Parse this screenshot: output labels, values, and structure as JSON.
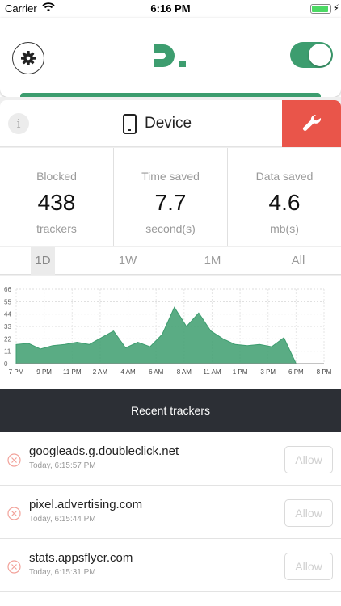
{
  "status_bar": {
    "carrier": "Carrier",
    "time": "6:16 PM"
  },
  "header": {
    "logo_icon": "disconnect-logo",
    "protection_on": true,
    "accent": "#3d9d6f"
  },
  "device": {
    "info_label": "i",
    "title": "Device",
    "wrench_color": "#e9554a"
  },
  "stats": [
    {
      "caption": "Blocked",
      "value": "438",
      "unit": "trackers"
    },
    {
      "caption": "Time saved",
      "value": "7.7",
      "unit": "second(s)"
    },
    {
      "caption": "Data saved",
      "value": "4.6",
      "unit": "mb(s)"
    }
  ],
  "range_tabs": [
    "1D",
    "1W",
    "1M",
    "All"
  ],
  "active_range": "1D",
  "chart_data": {
    "type": "area",
    "y_ticks": [
      0,
      11,
      22,
      33,
      44,
      55,
      66
    ],
    "ylim": [
      0,
      66
    ],
    "x_ticks": [
      "7 PM",
      "9 PM",
      "11 PM",
      "2 AM",
      "4 AM",
      "6 AM",
      "8 AM",
      "11 AM",
      "1 PM",
      "3 PM",
      "6 PM",
      "8 PM"
    ],
    "x": [
      0,
      1,
      2,
      3,
      4,
      5,
      6,
      7,
      8,
      9,
      10,
      11,
      12,
      13,
      14,
      15,
      16,
      17,
      18,
      19,
      20
    ],
    "values": [
      17,
      18,
      13,
      16,
      17,
      19,
      17,
      23,
      29,
      14,
      19,
      15,
      26,
      50,
      33,
      45,
      29,
      22,
      17,
      16,
      17,
      15,
      23,
      0
    ],
    "grid": true,
    "color": "#3d9d6f"
  },
  "recent": {
    "title": "Recent trackers",
    "items": [
      {
        "domain": "googleads.g.doubleclick.net",
        "time": "Today, 6:15:57 PM",
        "action": "Allow"
      },
      {
        "domain": "pixel.advertising.com",
        "time": "Today, 6:15:44 PM",
        "action": "Allow"
      },
      {
        "domain": "stats.appsflyer.com",
        "time": "Today, 6:15:31 PM",
        "action": "Allow"
      }
    ]
  }
}
